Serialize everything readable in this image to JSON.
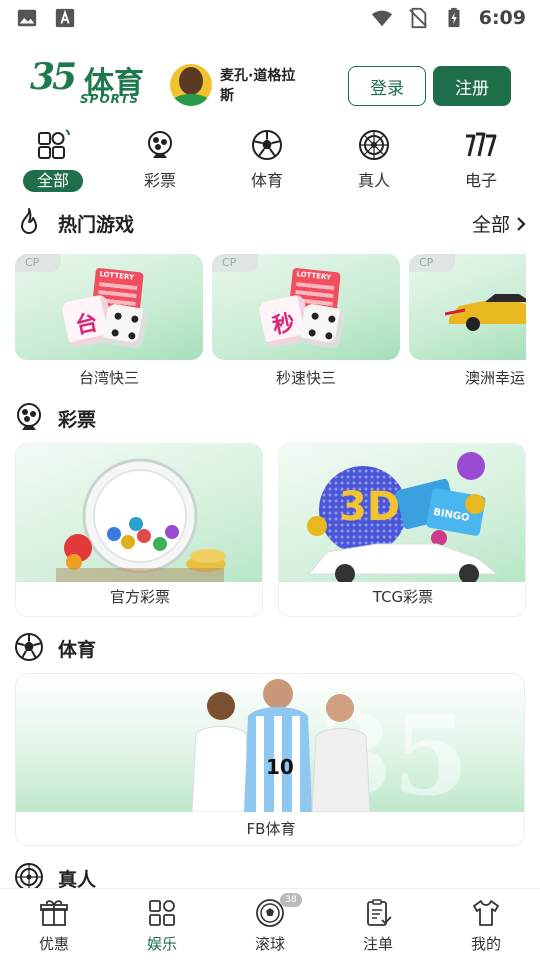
{
  "status_bar": {
    "time": "6:09",
    "left_icons": [
      "image-icon",
      "text-a-icon"
    ],
    "right_icons": [
      "wifi-icon",
      "no-sim-icon",
      "battery-charging-icon"
    ]
  },
  "header": {
    "logo_number": "35",
    "logo_cn": "体育",
    "logo_en": "SPORTS",
    "player_name": "麦孔·道格拉斯",
    "login_label": "登录",
    "register_label": "注册"
  },
  "categories": [
    {
      "label": "全部",
      "icon": "grid-icon",
      "active": true
    },
    {
      "label": "彩票",
      "icon": "lottery-ball-icon",
      "active": false
    },
    {
      "label": "体育",
      "icon": "soccer-ball-icon",
      "active": false
    },
    {
      "label": "真人",
      "icon": "roulette-icon",
      "active": false
    },
    {
      "label": "电子",
      "icon": "slot-777-icon",
      "active": false
    }
  ],
  "hot_games": {
    "title": "热门游戏",
    "more_label": "全部",
    "items": [
      {
        "badge": "CP",
        "label": "台湾快三",
        "ticket_text": "LOTTERY",
        "die_glyph": "台"
      },
      {
        "badge": "CP",
        "label": "秒速快三",
        "ticket_text": "LOTTERY",
        "die_glyph": "秒"
      },
      {
        "badge": "CP",
        "label": "澳洲幸运"
      }
    ]
  },
  "lottery": {
    "title": "彩票",
    "items": [
      {
        "label": "官方彩票"
      },
      {
        "label": "TCG彩票",
        "art_text": "3D",
        "ticket_text": "BINGO"
      }
    ]
  },
  "sports": {
    "title": "体育",
    "items": [
      {
        "label": "FB体育"
      }
    ]
  },
  "live": {
    "title": "真人"
  },
  "tabbar": [
    {
      "label": "优惠",
      "icon": "gift-icon",
      "active": false
    },
    {
      "label": "娱乐",
      "icon": "grid-icon",
      "active": true
    },
    {
      "label": "滚球",
      "icon": "soccer-ball-icon",
      "active": false,
      "badge": "38"
    },
    {
      "label": "注单",
      "icon": "clipboard-check-icon",
      "active": false
    },
    {
      "label": "我的",
      "icon": "user-shirt-icon",
      "active": false
    }
  ],
  "colors": {
    "brand_green": "#1f6e4a",
    "logo_green": "#1d7a4c"
  }
}
